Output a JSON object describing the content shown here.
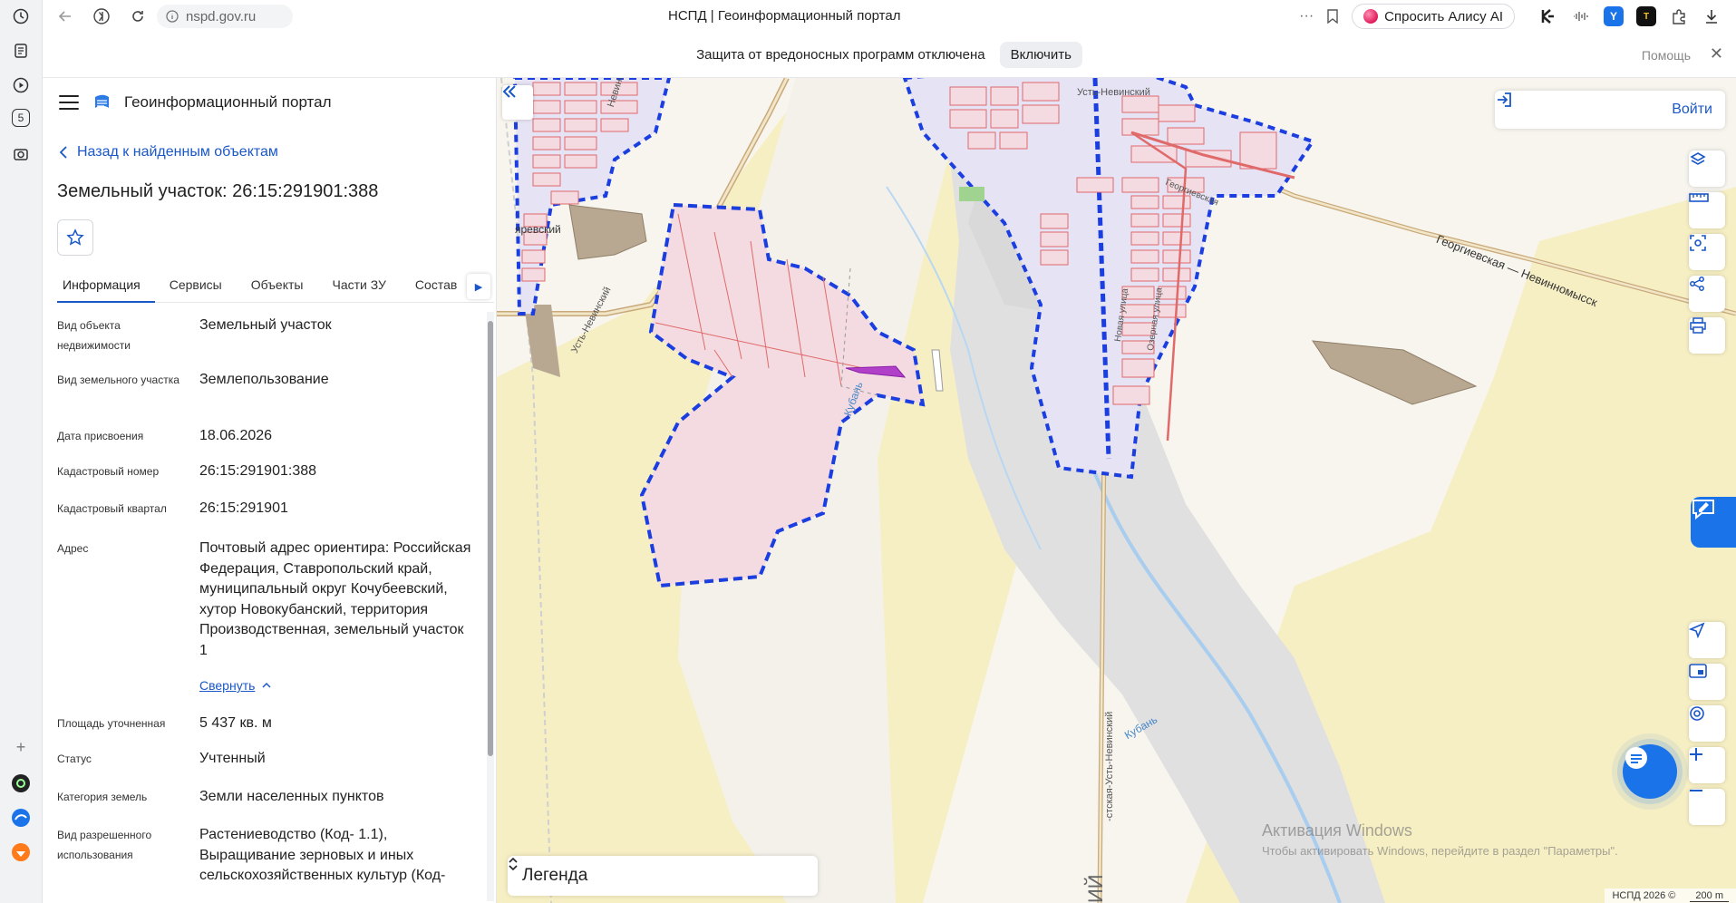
{
  "browser": {
    "url": "nspd.gov.ru",
    "tab_title": "НСПД | Геоинформационный портал",
    "alice_label": "Спросить Алису AI",
    "strip_badge": "5"
  },
  "warning": {
    "text": "Защита от вредоносных программ отключена",
    "enable_label": "Включить",
    "help_label": "Помощь"
  },
  "panel": {
    "portal_name": "Геоинформационный портал",
    "back_label": "Назад к найденным объектам",
    "title": "Земельный участок: 26:15:291901:388",
    "tabs": [
      {
        "label": "Информация"
      },
      {
        "label": "Сервисы"
      },
      {
        "label": "Объекты"
      },
      {
        "label": "Части ЗУ"
      },
      {
        "label": "Состав"
      }
    ],
    "rows": [
      {
        "key": "Вид объекта недвижимости",
        "value": "Земельный участок"
      },
      {
        "key": "Вид земельного участка",
        "value": "Землепользование"
      },
      {
        "key": "Дата присвоения",
        "value": "18.06.2026"
      },
      {
        "key": "Кадастровый номер",
        "value": "26:15:291901:388"
      },
      {
        "key": "Кадастровый квартал",
        "value": "26:15:291901"
      },
      {
        "key": "Адрес",
        "value": "Почтовый адрес ориентира: Российская Федерация, Ставропольский край, муниципальный округ Кочубеевский, хутор Новокубанский, территория Производственная, земельный участок 1"
      },
      {
        "key": "Площадь уточненная",
        "value": "5 437 кв. м"
      },
      {
        "key": "Статус",
        "value": "Учтенный"
      },
      {
        "key": "Категория земель",
        "value": "Земли населенных пунктов"
      },
      {
        "key": "Вид разрешенного использования",
        "value": "Растениеводство (Код- 1.1), Выращивание зерновых и иных сельскохозяйственных культур (Код-"
      }
    ],
    "collapse_label": "Свернуть"
  },
  "map": {
    "login_label": "Войти",
    "legend_label": "Легенда",
    "labels": {
      "ust_nevinsky": "Усть-Невинский",
      "nevinnomysskaya": "Невинномысская",
      "georgievskaya_ul": "Георгиевская",
      "georgievskaya_road": "Георгиевская — Невинномысск",
      "kuban1": "Кубань",
      "kuban2": "Кубань",
      "yarevsky": "яревский",
      "ust_road": "Усть-Невинский",
      "new_street": "Новая улица",
      "ozernaya": "Озерная улица",
      "ust_road_vertical": "-стская-Усть-Невинский",
      "big_letters": "ИЙ"
    },
    "windows_activation_title": "Активация Windows",
    "windows_activation_text": "Чтобы активировать Windows, перейдите в раздел \"Параметры\".",
    "copyright": "НСПД 2026 ©",
    "scale": "200 m"
  },
  "colors": {
    "accent": "#1a57c7",
    "parcel_fill": "#f3dbe1",
    "parcel_stroke": "#e06060",
    "boundary": "#1a3ee0",
    "settlement_fill": "#e6e3f5",
    "river": "#9cc8ee"
  }
}
